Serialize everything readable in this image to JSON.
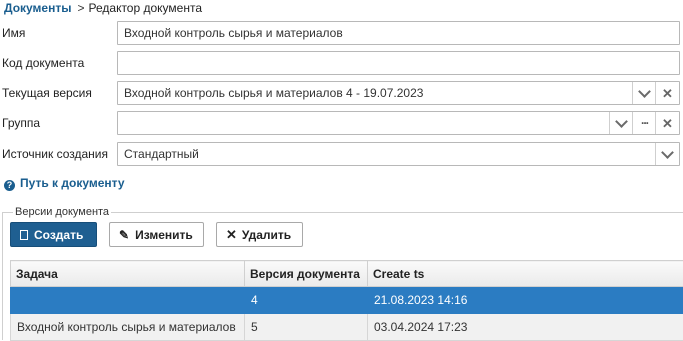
{
  "breadcrumb": {
    "root": "Документы",
    "separator": ">",
    "current": "Редактор документа"
  },
  "form": {
    "name": {
      "label": "Имя",
      "value": "Входной контроль сырья и материалов"
    },
    "code": {
      "label": "Код документа",
      "value": ""
    },
    "version": {
      "label": "Текущая версия",
      "value": "Входной контроль сырья и материалов 4 - 19.07.2023"
    },
    "group": {
      "label": "Группа",
      "value": ""
    },
    "source": {
      "label": "Источник создания",
      "value": "Стандартный"
    }
  },
  "path_link": {
    "label": "Путь к документу",
    "icon": "question-circle-icon"
  },
  "versions": {
    "legend": "Версии документа",
    "buttons": {
      "create": "Создать",
      "edit": "Изменить",
      "delete": "Удалить"
    },
    "columns": [
      "Задача",
      "Версия документа",
      "Create ts"
    ],
    "rows": [
      {
        "task": "",
        "version": "4",
        "created": "21.08.2023 14:16",
        "selected": true
      },
      {
        "task": "Входной контроль сырья и материалов",
        "version": "5",
        "created": "03.04.2024 17:23",
        "selected": false
      }
    ]
  },
  "colors": {
    "link": "#1a5e8f",
    "primary_button": "#1f5f91",
    "selected_row": "#2b7cc2"
  }
}
